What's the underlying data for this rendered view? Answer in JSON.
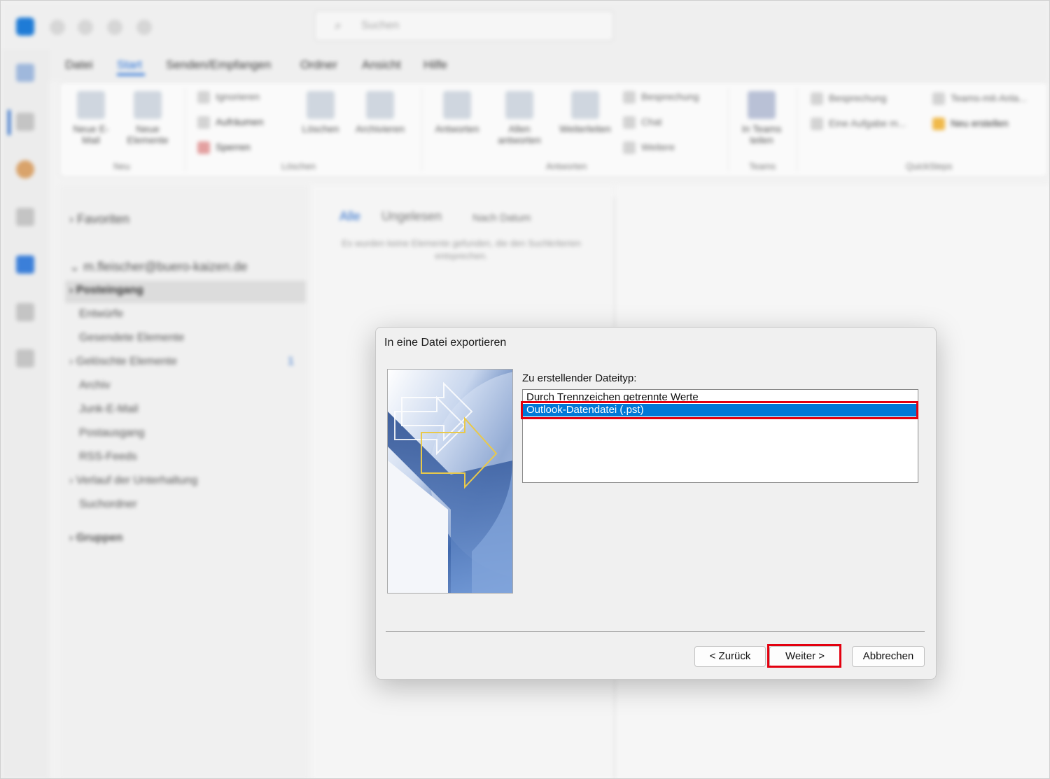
{
  "app": {
    "search_placeholder": "Suchen"
  },
  "ribbon_tabs": [
    "Datei",
    "Start",
    "Senden/Empfangen",
    "Ordner",
    "Ansicht",
    "Hilfe"
  ],
  "ribbon": {
    "new_mail": "Neue E-Mail",
    "new_items": "Neue Elemente",
    "ignore": "Ignorieren",
    "cleanup": "Aufräumen",
    "block": "Sperren",
    "delete": "Löschen",
    "archive": "Archivieren",
    "reply": "Antworten",
    "reply_all": "Allen antworten",
    "forward": "Weiterleiten",
    "meeting": "Besprechung",
    "chat": "Chat",
    "more": "Weitere",
    "share_teams": "In Teams teilen",
    "qs_meeting": "Besprechung",
    "qs_team_email": "Teams-mit-Anla...",
    "qs_task": "Eine Aufgabe m...",
    "qs_new": "Neu erstellen",
    "group_new": "Neu",
    "group_delete": "Löschen",
    "group_respond": "Antworten",
    "group_teams": "Teams",
    "group_quicksteps": "QuickSteps"
  },
  "folders": {
    "favorites": "Favoriten",
    "account": "m.fleischer@buero-kaizen.de",
    "items": [
      {
        "label": "Posteingang"
      },
      {
        "label": "Entwürfe"
      },
      {
        "label": "Gesendete Elemente"
      },
      {
        "label": "Gelöschte Elemente"
      },
      {
        "label": "Archiv"
      },
      {
        "label": "Junk-E-Mail"
      },
      {
        "label": "Postausgang"
      },
      {
        "label": "RSS-Feeds"
      },
      {
        "label": "Verlauf der Unterhaltung"
      },
      {
        "label": "Suchordner"
      }
    ],
    "deleted_count": "1",
    "groups": "Gruppen"
  },
  "maillist": {
    "tab_all": "Alle",
    "tab_unread": "Ungelesen",
    "sort": "Nach Datum",
    "empty": "Es wurden keine Elemente gefunden, die den Suchkriterien entsprechen."
  },
  "dialog": {
    "title": "In eine Datei exportieren",
    "list_label": "Zu erstellender Dateityp:",
    "options": [
      {
        "label": "Durch Trennzeichen getrennte Werte",
        "selected": false
      },
      {
        "label": "Outlook-Datendatei (.pst)",
        "selected": true
      }
    ],
    "back_button": "< Zurück",
    "next_button": "Weiter >",
    "cancel_button": "Abbrechen",
    "highlight_color": "#e3000f",
    "selection_color": "#0078d7"
  }
}
